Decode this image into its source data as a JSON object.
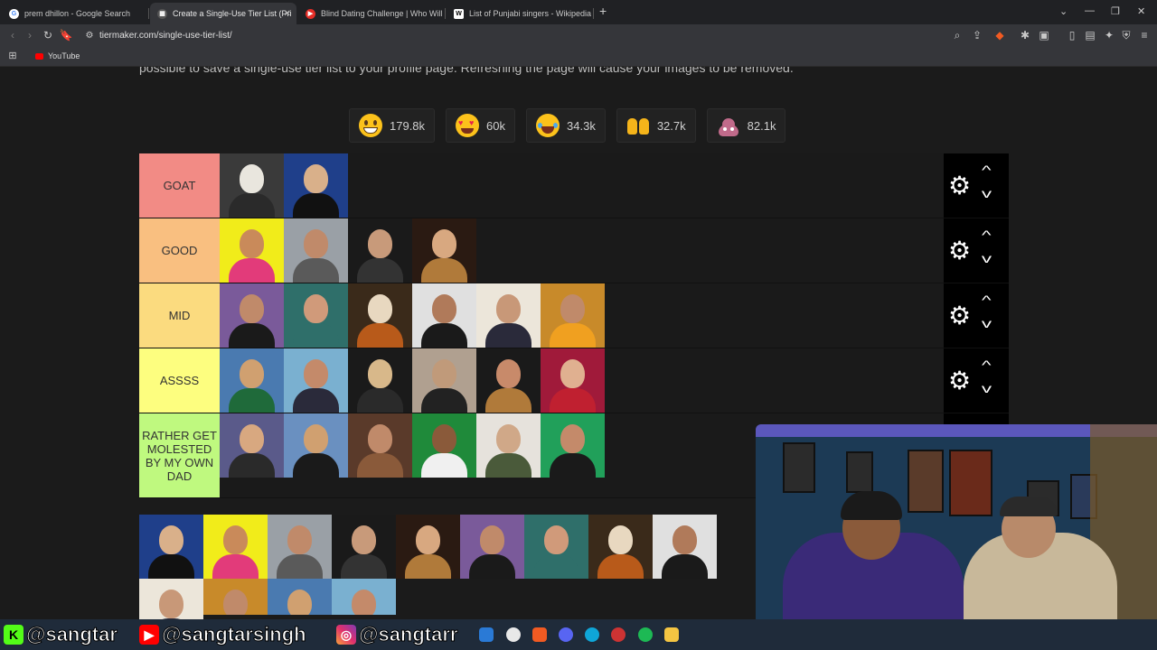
{
  "browser": {
    "tabs": [
      {
        "label": "prem dhillon - Google Search",
        "favicon": "google-icon"
      },
      {
        "label": "Create a Single-Use Tier List (Pri",
        "favicon": "tiermaker-icon",
        "active": true
      },
      {
        "label": "Blind Dating Challenge | Who Will Ki",
        "favicon": "youtube-icon"
      },
      {
        "label": "List of Punjabi singers - Wikipedia",
        "favicon": "wikipedia-icon"
      }
    ],
    "url": "tiermaker.com/single-use-tier-list/",
    "bookmark": "YouTube"
  },
  "page": {
    "intro_text": "possible to save a single-use tier list to your profile page. Refreshing the page will cause your images to be removed.",
    "reactions": [
      {
        "icon": "grin-emoji-icon",
        "count": "179.8k"
      },
      {
        "icon": "heart-eyes-emoji-icon",
        "count": "60k"
      },
      {
        "icon": "laughing-emoji-icon",
        "count": "34.3k"
      },
      {
        "icon": "raised-hands-emoji-icon",
        "count": "32.7k"
      },
      {
        "icon": "poop-emoji-icon",
        "count": "82.1k"
      }
    ],
    "tiers": [
      {
        "label": "GOAT",
        "color": "#f28b85",
        "images": 2
      },
      {
        "label": "GOOD",
        "color": "#f9bf80",
        "images": 4
      },
      {
        "label": "MID",
        "color": "#fbdb7f",
        "images": 6
      },
      {
        "label": "ASSSS",
        "color": "#fdfe7f",
        "images": 6
      },
      {
        "label": "RATHER GET MOLESTED BY MY OWN DAD",
        "color": "#bff97f",
        "images": 6
      }
    ],
    "pool_images": 13
  },
  "overlay": {
    "socials": [
      {
        "icon": "kick-icon",
        "handle": "@sangtar"
      },
      {
        "icon": "youtube-icon",
        "handle": "@sangtarsingh"
      },
      {
        "icon": "instagram-icon",
        "handle": "@sangtarr"
      }
    ]
  }
}
